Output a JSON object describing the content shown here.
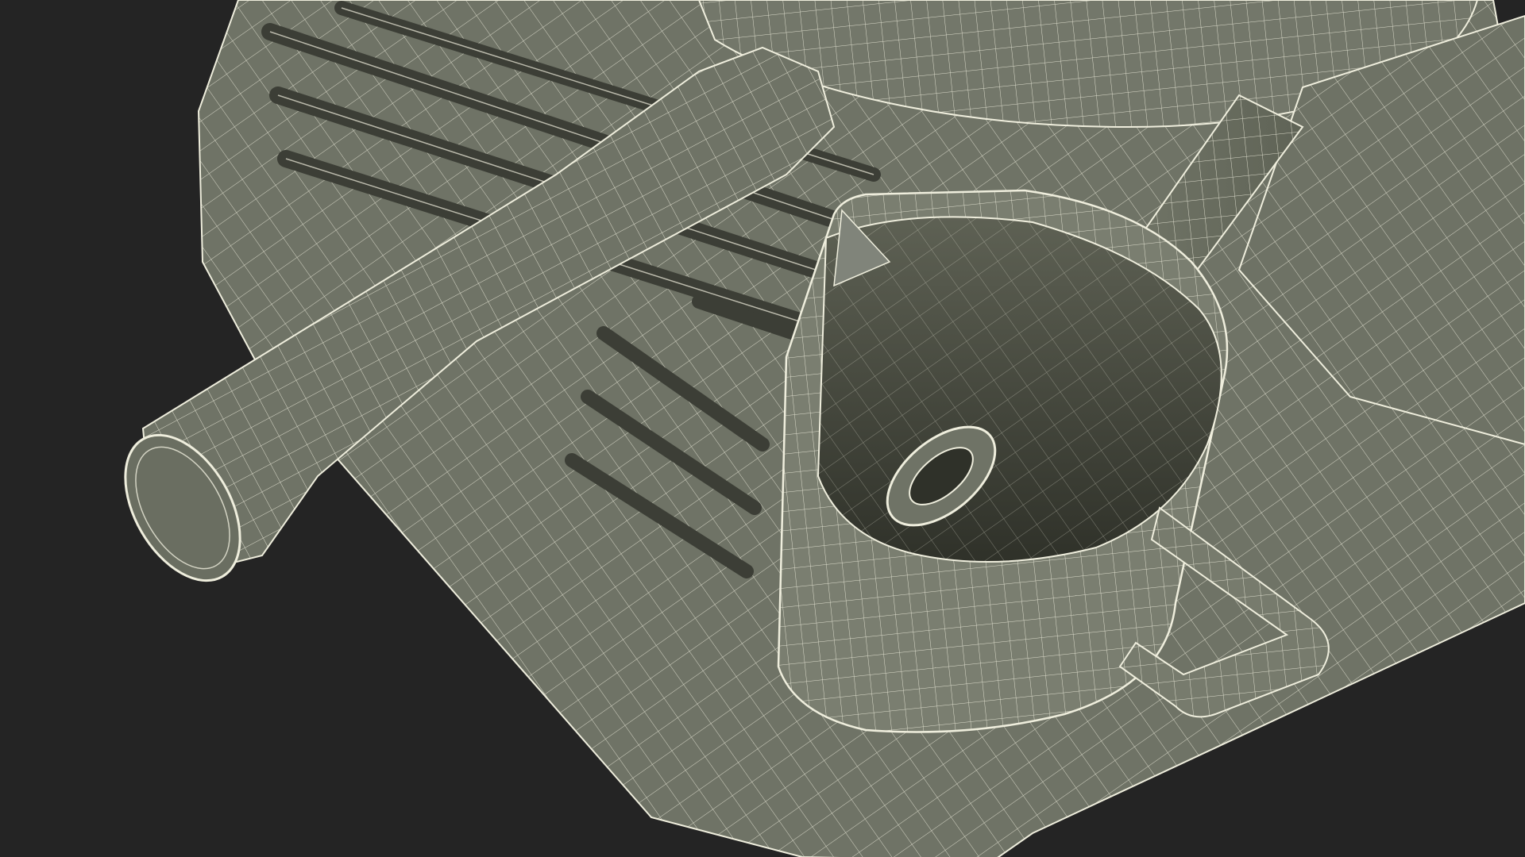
{
  "scene": {
    "background_color": "#242424",
    "surface_color": "#73776a",
    "surface_shadow_color": "#4b4e43",
    "wire_color": "#efeedd",
    "subject": "wireframe-espresso-machine-portafilter-milk-pitcher"
  }
}
